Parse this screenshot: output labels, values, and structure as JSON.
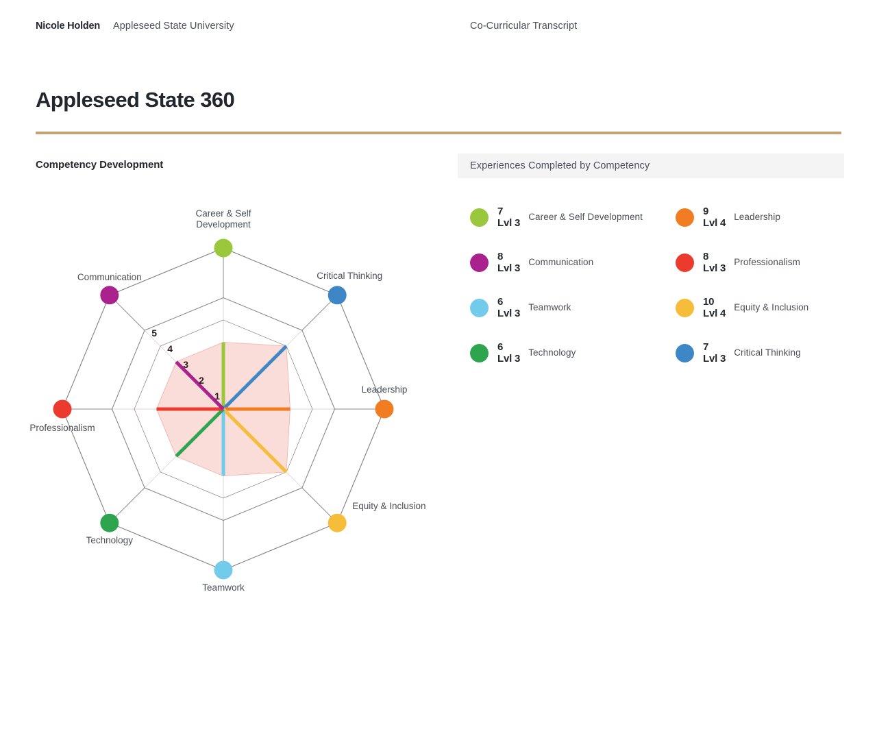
{
  "header": {
    "student_name": "Nicole Holden",
    "institution": "Appleseed State University",
    "document_type": "Co-Curricular Transcript"
  },
  "page_title": "Appleseed State 360",
  "accent_color": "#c4a274",
  "section": {
    "chart_heading": "Competency Development",
    "legend_heading": "Experiences Completed by Competency"
  },
  "legend": {
    "items": [
      {
        "count": "7",
        "level": "Lvl 3",
        "name": "Career & Self Development",
        "color": "#9ac73c"
      },
      {
        "count": "9",
        "level": "Lvl 4",
        "name": "Leadership",
        "color": "#f07d22"
      },
      {
        "count": "8",
        "level": "Lvl 3",
        "name": "Communication",
        "color": "#a9228e"
      },
      {
        "count": "8",
        "level": "Lvl 3",
        "name": "Professionalism",
        "color": "#ea3b2e"
      },
      {
        "count": "6",
        "level": "Lvl 3",
        "name": "Teamwork",
        "color": "#72cbea"
      },
      {
        "count": "10",
        "level": "Lvl 4",
        "name": "Equity & Inclusion",
        "color": "#f5bd3a"
      },
      {
        "count": "6",
        "level": "Lvl 3",
        "name": "Technology",
        "color": "#2ea44f"
      },
      {
        "count": "7",
        "level": "Lvl 3",
        "name": "Critical Thinking",
        "color": "#3d87c6"
      }
    ]
  },
  "chart_data": {
    "type": "radar",
    "title": "Competency Development",
    "rings": [
      1,
      2,
      3,
      4,
      5
    ],
    "tick_labels": [
      "1",
      "2",
      "3",
      "4",
      "5"
    ],
    "rmax": 5,
    "grid": true,
    "fill_color": "#fadcd9",
    "categories": [
      "Career & Self Development",
      "Critical Thinking",
      "Leadership",
      "Equity & Inclusion",
      "Teamwork",
      "Technology",
      "Professionalism",
      "Communication"
    ],
    "values": [
      3,
      4,
      3,
      4,
      3,
      3,
      3,
      3
    ],
    "colors": [
      "#9ac73c",
      "#3d87c6",
      "#f07d22",
      "#f5bd3a",
      "#72cbea",
      "#2ea44f",
      "#ea3b2e",
      "#a9228e"
    ],
    "axis_labels": [
      "Career & Self\nDevelopment",
      "Critical Thinking",
      "Leadership",
      "Equity & Inclusion",
      "Teamwork",
      "Technology",
      "Professionalism",
      "Communication"
    ],
    "axis_label_text": {
      "career": "Career & Self",
      "career2": "Development",
      "critical": "Critical Thinking",
      "leadership": "Leadership",
      "equity": "Equity & Inclusion",
      "teamwork": "Teamwork",
      "technology": "Technology",
      "professionalism": "Professionalism",
      "communication": "Communication"
    }
  }
}
